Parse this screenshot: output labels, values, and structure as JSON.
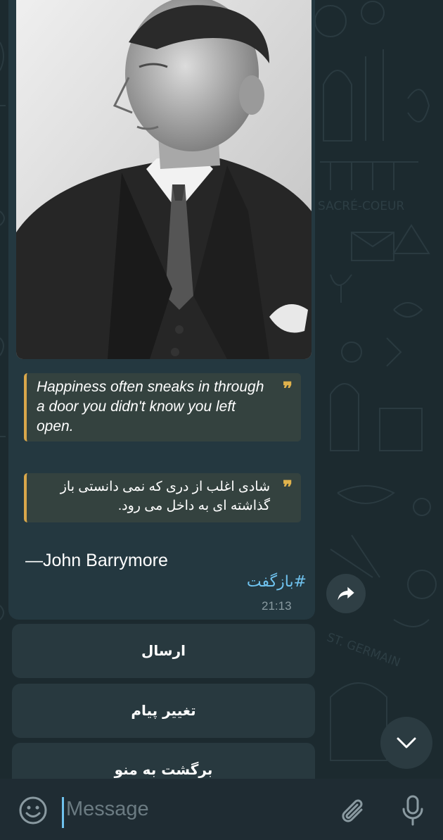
{
  "message": {
    "photo_alt": "Black and white portrait photo",
    "quote_en": "Happiness often sneaks in through a door you didn't know you left open.",
    "quote_fa": "شادی اغلب از دری که نمی دانستی باز گذاشته ای به داخل می رود.",
    "quote_mark": "❞",
    "author": "—John Barrymore",
    "hashtag": "#بازگفت",
    "time": "21:13"
  },
  "keyboard": {
    "buttons": [
      {
        "label": "ارسال"
      },
      {
        "label": "تغییر پیام"
      },
      {
        "label": "برگشت به منو"
      }
    ]
  },
  "input": {
    "placeholder": "Message"
  },
  "colors": {
    "background": "#1c2a2f",
    "bubble": "#243840",
    "quote_bg": "#34423f",
    "quote_border": "#d9a74b",
    "link": "#6fc2ee",
    "keyboard_button": "#28393f"
  },
  "icons": {
    "share": "share-arrow-icon",
    "scroll_down": "chevron-down-icon",
    "emoji": "emoji-smile-icon",
    "attach": "paperclip-icon",
    "mic": "microphone-icon"
  }
}
